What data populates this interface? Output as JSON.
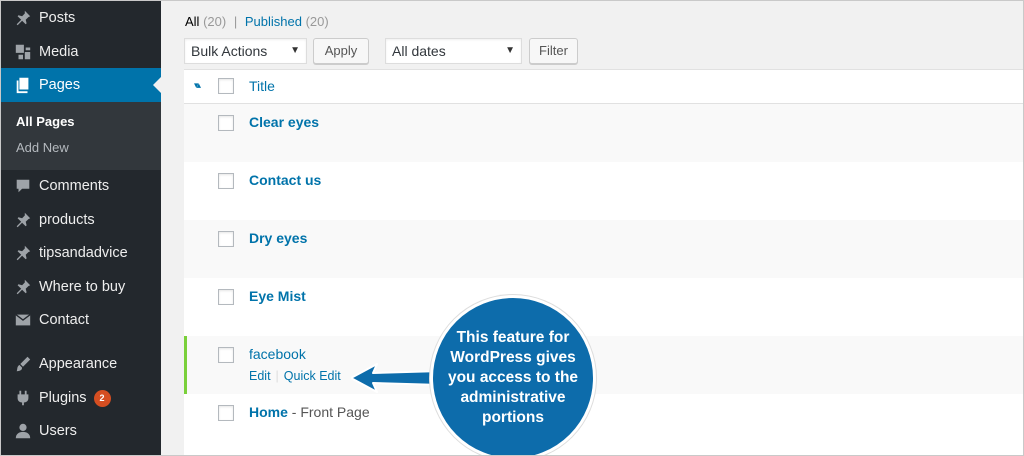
{
  "sidebar": {
    "items": [
      {
        "label": "Posts",
        "icon": "pin-icon"
      },
      {
        "label": "Media",
        "icon": "media-icon"
      },
      {
        "label": "Pages",
        "icon": "pages-icon"
      },
      {
        "label": "Comments",
        "icon": "comment-icon"
      },
      {
        "label": "products",
        "icon": "pin-icon"
      },
      {
        "label": "tipsandadvice",
        "icon": "pin-icon"
      },
      {
        "label": "Where to buy",
        "icon": "pin-icon"
      },
      {
        "label": "Contact",
        "icon": "mail-icon"
      },
      {
        "label": "Appearance",
        "icon": "brush-icon"
      },
      {
        "label": "Plugins",
        "icon": "plugin-icon",
        "badge": "2"
      },
      {
        "label": "Users",
        "icon": "user-icon"
      }
    ],
    "submenu": {
      "current": "All Pages",
      "other": "Add New"
    }
  },
  "filters": {
    "all_label": "All",
    "all_count": "(20)",
    "separator": "|",
    "published_label": "Published",
    "published_count": "(20)"
  },
  "toolbar": {
    "bulk_actions": "Bulk Actions",
    "apply": "Apply",
    "dates": "All dates",
    "filter": "Filter"
  },
  "table": {
    "header_title": "Title",
    "rows": [
      {
        "title": "Clear eyes"
      },
      {
        "title": "Contact us"
      },
      {
        "title": "Dry eyes"
      },
      {
        "title": "Eye Mist"
      },
      {
        "title": "facebook",
        "actions": [
          "Edit",
          "Quick Edit"
        ]
      },
      {
        "title": "Home",
        "suffix": " - Front Page"
      }
    ]
  },
  "callout": {
    "text": "This feature for WordPress gives you access to the administrative portions"
  },
  "colors": {
    "sidebar": "#23282d",
    "active": "#0073aa",
    "callout": "#0d6cab",
    "badge": "#d54e21",
    "highlight_bar": "#7ad03a"
  }
}
